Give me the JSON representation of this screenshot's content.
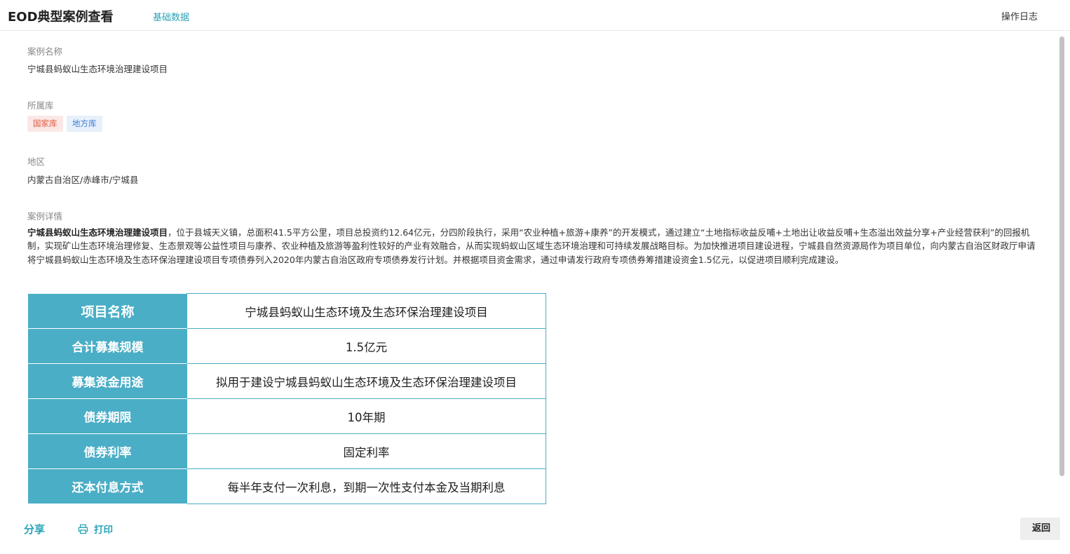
{
  "header": {
    "title": "EOD典型案例查看",
    "tab_basic": "基础数据",
    "op_log": "操作日志"
  },
  "fields": {
    "case_name_label": "案例名称",
    "case_name_value": "宁城县蚂蚁山生态环境治理建设项目",
    "library_label": "所属库",
    "library_tags": [
      "国家库",
      "地方库"
    ],
    "region_label": "地区",
    "region_value": "内蒙古自治区/赤峰市/宁城县",
    "detail_label": "案例详情"
  },
  "detail": {
    "bold_lead": "宁城县蚂蚁山生态环境治理建设项目",
    "body": "，位于县城天义镇，总面积41.5平方公里，项目总投资约12.64亿元，分四阶段执行，采用“农业种植+旅游+康养”的开发模式，通过建立“土地指标收益反哺+土地出让收益反哺+生态溢出效益分享+产业经营获利”的回报机制，实现矿山生态环境治理修复、生态景观等公益性项目与康养、农业种植及旅游等盈利性较好的产业有效融合，从而实现蚂蚁山区域生态环境治理和可持续发展战略目标。为加快推进项目建设进程，宁城县自然资源局作为项目单位，向内蒙古自治区财政厅申请将宁城县蚂蚁山生态环境及生态环保治理建设项目专项债券列入2020年内蒙古自治区政府专项债券发行计划。并根据项目资金需求，通过申请发行政府专项债券筹措建设资金1.5亿元，以促进项目顺利完成建设。"
  },
  "table": {
    "rows": [
      {
        "key": "项目名称",
        "value": "宁城县蚂蚁山生态环境及生态环保治理建设项目"
      },
      {
        "key": "合计募集规模",
        "value": "1.5亿元"
      },
      {
        "key": "募集资金用途",
        "value": "拟用于建设宁城县蚂蚁山生态环境及生态环保治理建设项目"
      },
      {
        "key": "债券期限",
        "value": "10年期"
      },
      {
        "key": "债券利率",
        "value": "固定利率"
      },
      {
        "key": "还本付息方式",
        "value": "每半年支付一次利息，到期一次性支付本金及当期利息"
      }
    ]
  },
  "actions": {
    "share": "分享",
    "print": "打印",
    "back": "返回"
  },
  "icons": {
    "print": "printer-icon"
  },
  "colors": {
    "accent": "#2aa3b8",
    "table_header_bg": "#4aaec6",
    "tag_national_bg": "#fbe8e6",
    "tag_national_text": "#e0563f",
    "tag_local_bg": "#e7f0fb",
    "tag_local_text": "#3f7fd4"
  }
}
